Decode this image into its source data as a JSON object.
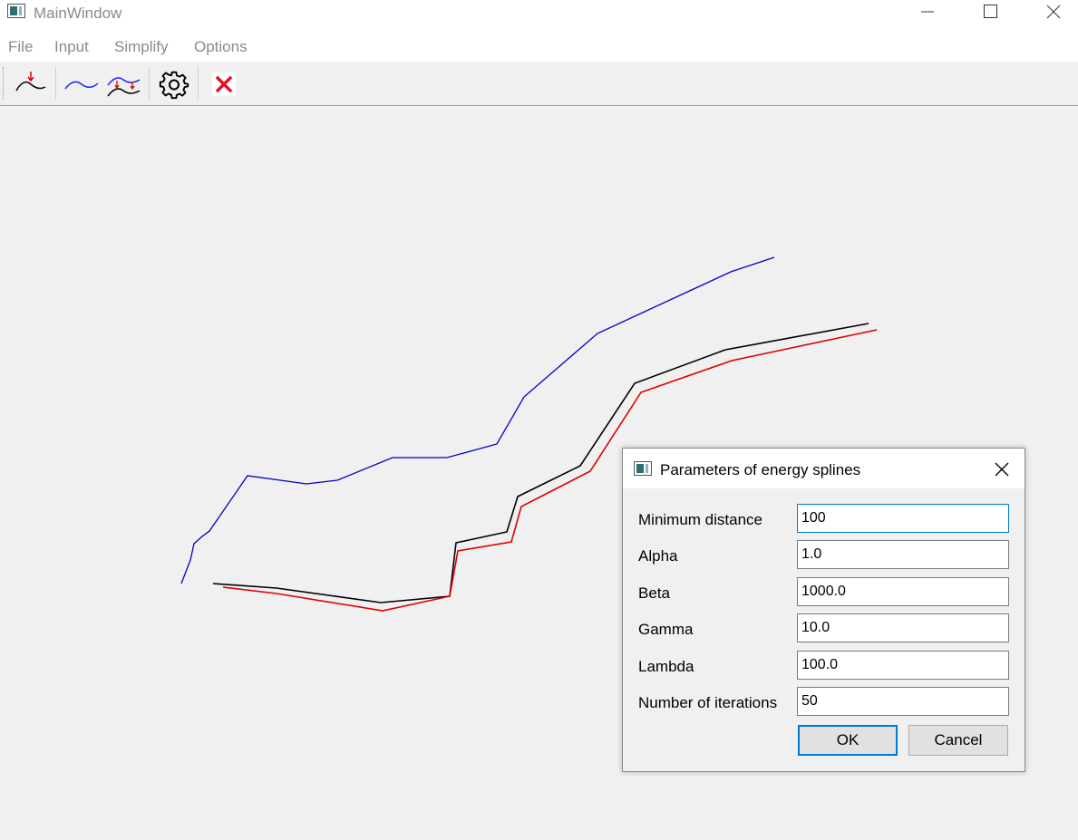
{
  "window": {
    "title": "MainWindow"
  },
  "menu": {
    "items": [
      "File",
      "Input",
      "Simplify",
      "Options"
    ]
  },
  "toolbar": {
    "tools": [
      {
        "icon": "input-point-icon"
      },
      {
        "icon": "curve-icon"
      },
      {
        "icon": "energy-spline-icon"
      },
      {
        "icon": "gear-icon"
      },
      {
        "icon": "close-icon"
      }
    ]
  },
  "colors": {
    "blue_line": "#0000c8",
    "black_line": "#000000",
    "red_line": "#e00000",
    "accent": "#0078d7",
    "close_red": "#e81123"
  },
  "dialog": {
    "title": "Parameters of energy splines",
    "fields": [
      {
        "label": "Minimum distance",
        "value": "100"
      },
      {
        "label": "Alpha",
        "value": "1.0"
      },
      {
        "label": "Beta",
        "value": "1000.0"
      },
      {
        "label": "Gamma",
        "value": "10.0"
      },
      {
        "label": "Lambda",
        "value": "100.0"
      },
      {
        "label": "Number of iterations",
        "value": "50"
      }
    ],
    "ok_label": "OK",
    "cancel_label": "Cancel"
  }
}
